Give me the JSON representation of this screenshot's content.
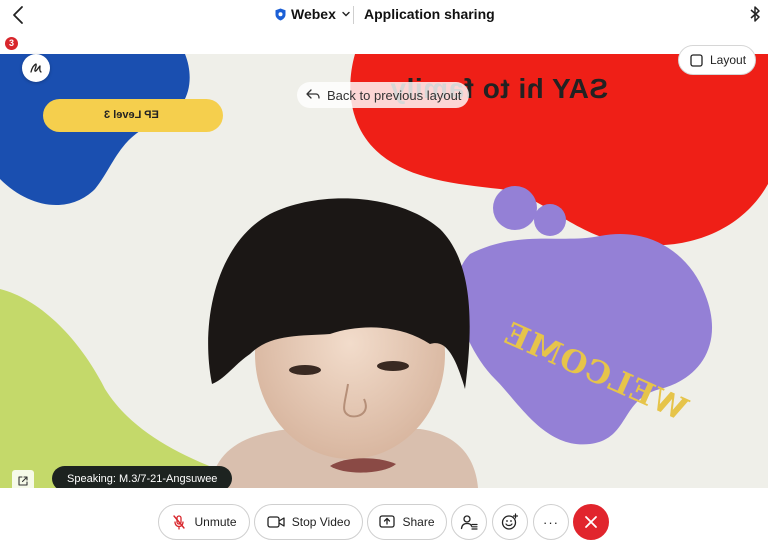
{
  "header": {
    "brand": "Webex",
    "title": "Application sharing"
  },
  "notification_count": "3",
  "shared_content": {
    "banner_text": "SAY hi to family",
    "level_label": "EP Level 3",
    "welcome_text": "WELCOME"
  },
  "overlay": {
    "back_to_layout_label": "Back to previous layout",
    "layout_label": "Layout",
    "speaking_label": "Speaking: M.3/7-21-Angsuwee"
  },
  "controls": {
    "unmute_label": "Unmute",
    "stop_video_label": "Stop Video",
    "share_label": "Share",
    "more_label": "···"
  },
  "colors": {
    "end_call": "#e1252d",
    "blob_blue": "#1a4fb0",
    "blob_red": "#ef1f17",
    "blob_purple": "#9480d6",
    "blob_green": "#c4d96a",
    "pill_yellow": "#f5cf4d",
    "welcome_text": "#e6c44a"
  },
  "icons": [
    "back-chevron-icon",
    "webex-shield-icon",
    "chevron-down-icon",
    "bluetooth-icon",
    "annotate-icon",
    "back-arrow-icon",
    "layout-square-icon",
    "popout-icon",
    "mic-muted-icon",
    "video-camera-icon",
    "share-screen-icon",
    "participants-icon",
    "reactions-icon",
    "close-x-icon"
  ]
}
